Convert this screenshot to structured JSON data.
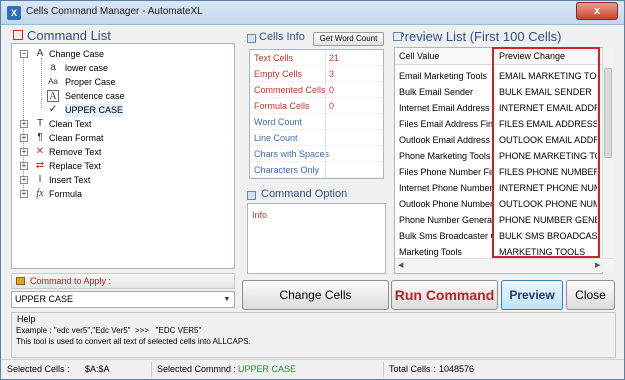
{
  "window": {
    "title": "Cells Command Manager - AutomateXL",
    "close_label": "x"
  },
  "command_list": {
    "title": "Command List",
    "items": [
      {
        "label": "Change Case",
        "expanded": true,
        "icon": "change-case-icon",
        "children": [
          {
            "label": "lower case",
            "icon": "lowercase-icon"
          },
          {
            "label": "Proper Case",
            "icon": "propercase-icon"
          },
          {
            "label": "Sentence case",
            "icon": "sentencecase-icon"
          },
          {
            "label": "UPPER CASE",
            "icon": "checkmark-icon",
            "selected": true
          }
        ]
      },
      {
        "label": "Clean Text",
        "icon": "clean-text-icon"
      },
      {
        "label": "Clean Format",
        "icon": "clean-format-icon"
      },
      {
        "label": "Remove Text",
        "icon": "remove-text-icon"
      },
      {
        "label": "Replace Text",
        "icon": "replace-text-icon"
      },
      {
        "label": "Insert Text",
        "icon": "insert-text-icon"
      },
      {
        "label": "Formula",
        "icon": "formula-icon"
      }
    ],
    "apply_label": "Command to Apply :",
    "apply_value": "UPPER CASE"
  },
  "cells_info": {
    "title": "Cells Info",
    "word_count_button": "Get Word Count",
    "rows": [
      {
        "label": "Text Cells",
        "value": "21"
      },
      {
        "label": "Empty Cells",
        "value": "3"
      },
      {
        "label": "Commented Cells",
        "value": "0"
      },
      {
        "label": "Formula Cells",
        "value": "0"
      },
      {
        "label": "Word Count",
        "value": ""
      },
      {
        "label": "Line Count",
        "value": ""
      },
      {
        "label": "Chars with Spaces",
        "value": ""
      },
      {
        "label": "Characters Only",
        "value": ""
      }
    ]
  },
  "command_option": {
    "title": "Command Option",
    "info": "Info"
  },
  "preview": {
    "title": "Preview List (First 100 Cells)",
    "col1": "Cell Value",
    "col2": "Preview Change",
    "rows": [
      {
        "value": "Email Marketing Tools",
        "preview": "EMAIL MARKETING TOOLS"
      },
      {
        "value": "Bulk Email Sender",
        "preview": "BULK EMAIL SENDER"
      },
      {
        "value": "Internet Email Address F...",
        "preview": "INTERNET EMAIL ADDRE..."
      },
      {
        "value": "Files Email Address Finder",
        "preview": "FILES EMAIL ADDRESS FI..."
      },
      {
        "value": "Outlook Email Address ...",
        "preview": "OUTLOOK EMAIL ADDRE..."
      },
      {
        "value": "Phone Marketing Tools",
        "preview": "PHONE MARKETING TOOLS"
      },
      {
        "value": "Files Phone Number Fin...",
        "preview": "FILES PHONE NUMBER F..."
      },
      {
        "value": "Internet Phone Number ...",
        "preview": "INTERNET PHONE NUMB..."
      },
      {
        "value": "Outlook Phone Number ...",
        "preview": "OUTLOOK PHONE NUMB..."
      },
      {
        "value": "Phone Number Generator",
        "preview": "PHONE NUMBER GENER..."
      },
      {
        "value": "Bulk Sms Broadcaster G...",
        "preview": "BULK SMS BROADCASTE..."
      },
      {
        "value": "Marketing Tools",
        "preview": "MARKETING TOOLS"
      }
    ]
  },
  "buttons": {
    "change_cells": "Change Cells",
    "run_command": "Run Command",
    "preview": "Preview",
    "close": "Close"
  },
  "help": {
    "title": "Help",
    "example": "Example : \"edc ver5\",\"Edc Ver5\"  >>>   \"EDC VER5\"",
    "description": "This tool is used to convert all text of selected cells into ALLCAPS."
  },
  "status": {
    "selected_cells_label": "Selected Cells :",
    "selected_cells_value": "$A:$A",
    "selected_command_label": "Selected Commnd :",
    "selected_command_value": "UPPER CASE",
    "total_cells_label": "Total Cells :",
    "total_cells_value": "1048576"
  },
  "colors": {
    "accent": "#2b4f8c",
    "danger": "#c0392b",
    "highlight_border": "#d4202a",
    "status_green": "#2a8b2a"
  }
}
